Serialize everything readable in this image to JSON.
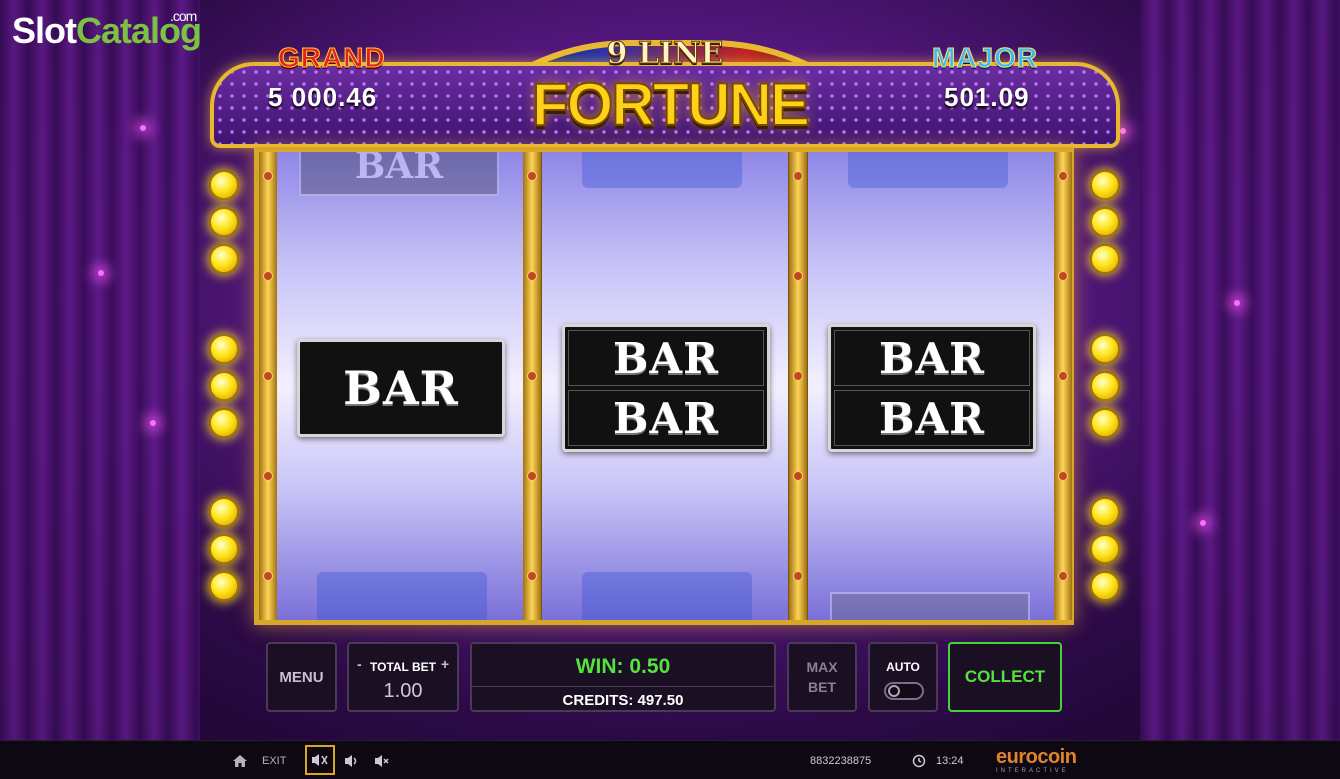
{
  "watermark": {
    "slot": "Slot",
    "catalog": "Catalog",
    "com": ".com"
  },
  "jackpots": {
    "grand": {
      "label": "GRAND",
      "value": "5 000.46"
    },
    "major": {
      "label": "MAJOR",
      "value": "501.09"
    }
  },
  "game": {
    "title_top": "9 LINE",
    "title_main": "FORTUNE"
  },
  "reels": [
    {
      "symbol": "BAR",
      "type": "single"
    },
    {
      "symbol": "BAR",
      "type": "double"
    },
    {
      "symbol": "BAR",
      "type": "double"
    }
  ],
  "controls": {
    "menu_label": "MENU",
    "total_bet_label": "TOTAL BET",
    "total_bet_minus": "-",
    "total_bet_plus": "+",
    "total_bet_value": "1.00",
    "win_text": "WIN: 0.50",
    "credits_text": "CREDITS: 497.50",
    "max_bet_line1": "MAX",
    "max_bet_line2": "BET",
    "auto_label": "AUTO",
    "collect_label": "COLLECT"
  },
  "bottombar": {
    "exit_label": "EXIT",
    "session_id": "8832238875",
    "time": "13:24",
    "brand_name": "eurocoin",
    "brand_sub": "INTERACTIVE"
  },
  "icons": {
    "home": "home-icon",
    "sound_settings": "sound-settings-icon",
    "volume": "volume-icon",
    "mute": "mute-icon",
    "clock": "clock-icon"
  },
  "colors": {
    "win_green": "#55e23c",
    "gold_frame": "#d8a628",
    "grand_red": "#e0202a",
    "major_blue": "#3ab8ff",
    "brand_orange": "#e0832a"
  }
}
